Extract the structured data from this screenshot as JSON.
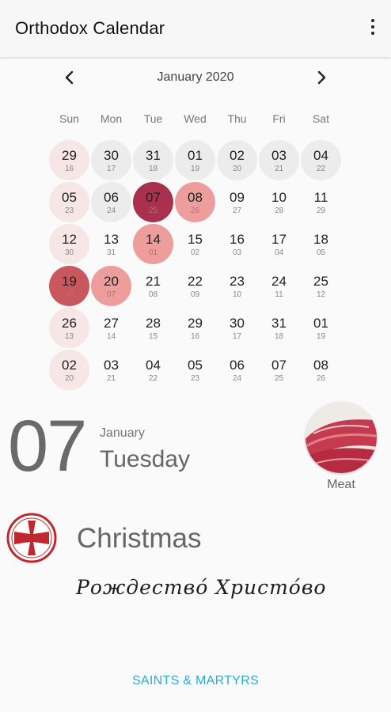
{
  "app": {
    "title": "Orthodox Calendar"
  },
  "calendar": {
    "month_label": "January 2020",
    "weekdays": [
      "Sun",
      "Mon",
      "Tue",
      "Wed",
      "Thu",
      "Fri",
      "Sat"
    ],
    "days": [
      {
        "d": "29",
        "j": "16",
        "s": "pink"
      },
      {
        "d": "30",
        "j": "17",
        "s": "light"
      },
      {
        "d": "31",
        "j": "18",
        "s": "light"
      },
      {
        "d": "01",
        "j": "19",
        "s": "light"
      },
      {
        "d": "02",
        "j": "20",
        "s": "light"
      },
      {
        "d": "03",
        "j": "21",
        "s": "light"
      },
      {
        "d": "04",
        "j": "22",
        "s": "light"
      },
      {
        "d": "05",
        "j": "23",
        "s": "pink"
      },
      {
        "d": "06",
        "j": "24",
        "s": "light"
      },
      {
        "d": "07",
        "j": "25",
        "s": "dark"
      },
      {
        "d": "08",
        "j": "26",
        "s": "salmon"
      },
      {
        "d": "09",
        "j": "27",
        "s": ""
      },
      {
        "d": "10",
        "j": "28",
        "s": ""
      },
      {
        "d": "11",
        "j": "29",
        "s": ""
      },
      {
        "d": "12",
        "j": "30",
        "s": "pink"
      },
      {
        "d": "13",
        "j": "31",
        "s": ""
      },
      {
        "d": "14",
        "j": "01",
        "s": "salmon"
      },
      {
        "d": "15",
        "j": "02",
        "s": ""
      },
      {
        "d": "16",
        "j": "03",
        "s": ""
      },
      {
        "d": "17",
        "j": "04",
        "s": ""
      },
      {
        "d": "18",
        "j": "05",
        "s": ""
      },
      {
        "d": "19",
        "j": "06",
        "s": "red"
      },
      {
        "d": "20",
        "j": "07",
        "s": "salmon"
      },
      {
        "d": "21",
        "j": "08",
        "s": ""
      },
      {
        "d": "22",
        "j": "09",
        "s": ""
      },
      {
        "d": "23",
        "j": "10",
        "s": ""
      },
      {
        "d": "24",
        "j": "11",
        "s": ""
      },
      {
        "d": "25",
        "j": "12",
        "s": ""
      },
      {
        "d": "26",
        "j": "13",
        "s": "pink"
      },
      {
        "d": "27",
        "j": "14",
        "s": ""
      },
      {
        "d": "28",
        "j": "15",
        "s": ""
      },
      {
        "d": "29",
        "j": "16",
        "s": ""
      },
      {
        "d": "30",
        "j": "17",
        "s": ""
      },
      {
        "d": "31",
        "j": "18",
        "s": ""
      },
      {
        "d": "01",
        "j": "19",
        "s": ""
      },
      {
        "d": "02",
        "j": "20",
        "s": "pink"
      },
      {
        "d": "03",
        "j": "21",
        "s": ""
      },
      {
        "d": "04",
        "j": "22",
        "s": ""
      },
      {
        "d": "05",
        "j": "23",
        "s": ""
      },
      {
        "d": "06",
        "j": "24",
        "s": ""
      },
      {
        "d": "07",
        "j": "25",
        "s": ""
      },
      {
        "d": "08",
        "j": "26",
        "s": ""
      }
    ]
  },
  "selected": {
    "day": "07",
    "month": "January",
    "weekday": "Tuesday",
    "fasting_label": "Meat",
    "fasting_icon": "meat-image",
    "feast_icon": "cross-icon",
    "feast_title": "Christmas",
    "feast_slavonic": "Рождество́ Христо́во"
  },
  "footer": {
    "saints_button": "SAINTS & MARTYRS"
  },
  "colors": {
    "accent": "#2aa9e0",
    "feast_dark": "#a8324d",
    "feast_red": "#c8575e",
    "fast_salmon": "#ee9d9d",
    "sunday_pink": "#f6e6e6",
    "prev_month_gray": "#ececec"
  }
}
